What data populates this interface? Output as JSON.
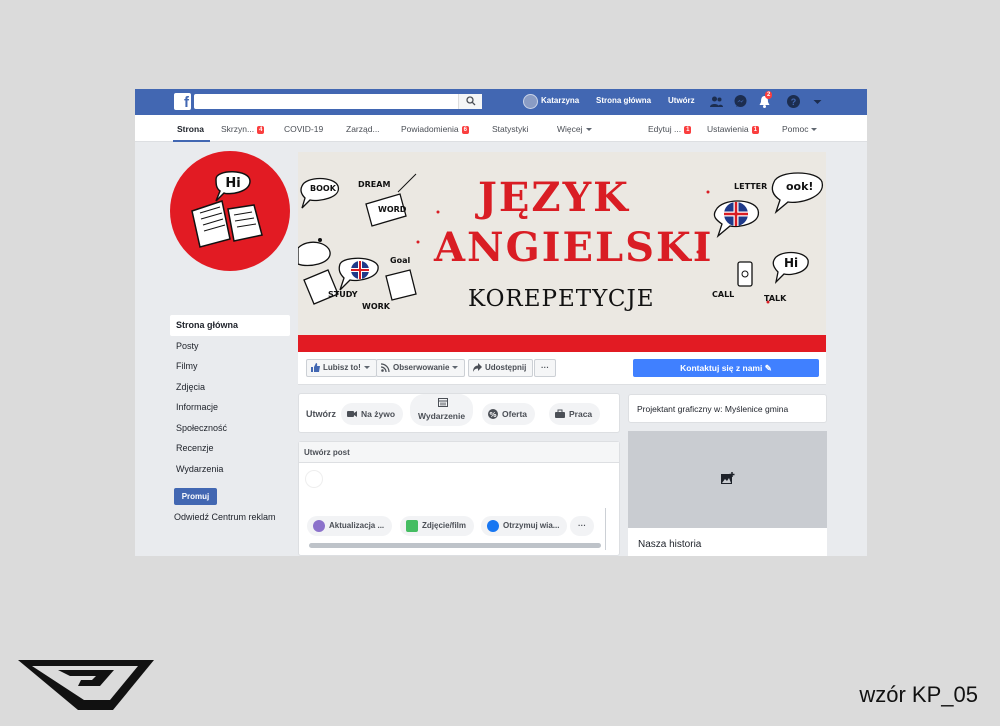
{
  "topbar": {
    "user_name": "Katarzyna",
    "home_label": "Strona główna",
    "create_label": "Utwórz",
    "notifications_count": "2"
  },
  "page_nav": {
    "items": [
      {
        "label": "Strona",
        "badge": ""
      },
      {
        "label": "Skrzyn...",
        "badge": "4"
      },
      {
        "label": "COVID-19",
        "badge": ""
      },
      {
        "label": "Zarząd...",
        "badge": ""
      },
      {
        "label": "Powiadomienia",
        "badge": "6"
      },
      {
        "label": "Statystyki",
        "badge": ""
      },
      {
        "label": "Więcej",
        "badge": ""
      },
      {
        "label": "Edytuj ...",
        "badge": "1"
      },
      {
        "label": "Ustawienia",
        "badge": "1"
      },
      {
        "label": "Pomoc",
        "badge": ""
      }
    ]
  },
  "left_menu": {
    "items": [
      "Strona główna",
      "Posty",
      "Filmy",
      "Zdjęcia",
      "Informacje",
      "Społeczność",
      "Recenzje",
      "Wydarzenia"
    ],
    "promote_label": "Promuj",
    "ads_center_label": "Odwiedź Centrum reklam"
  },
  "cover": {
    "title_line1": "JĘZYK",
    "title_line2": "ANGIELSKI",
    "subtitle": "KOREPETYCJE",
    "doodles": [
      "DREAM",
      "BOOK",
      "WORD",
      "LETTER",
      "Goal",
      "STUDY",
      "WORK",
      "CALL",
      "TALK",
      "Hi",
      "ook!"
    ],
    "logo_text": "Hi"
  },
  "actions": {
    "like_label": "Lubisz to!",
    "follow_label": "Obserwowanie",
    "share_label": "Udostępnij",
    "more_label": "···",
    "contact_label": "Kontaktuj się z nami"
  },
  "composer": {
    "create_label": "Utwórz",
    "tabs": [
      "Na żywo",
      "Wydarzenie",
      "Oferta",
      "Praca"
    ]
  },
  "post": {
    "header": "Utwórz post",
    "buttons": [
      "Aktualizacja ...",
      "Zdjęcie/film",
      "Otrzymuj wia..."
    ],
    "more_label": "···"
  },
  "right": {
    "category": "Projektant graficzny w: Myślenice gmina",
    "story_title": "Nasza historia"
  },
  "caption": "wzór KP_05",
  "colors": {
    "facebook_blue": "#4267b2",
    "contact_blue": "#4080ff",
    "brand_red": "#e21b23",
    "badge_red": "#fa3e3e"
  }
}
